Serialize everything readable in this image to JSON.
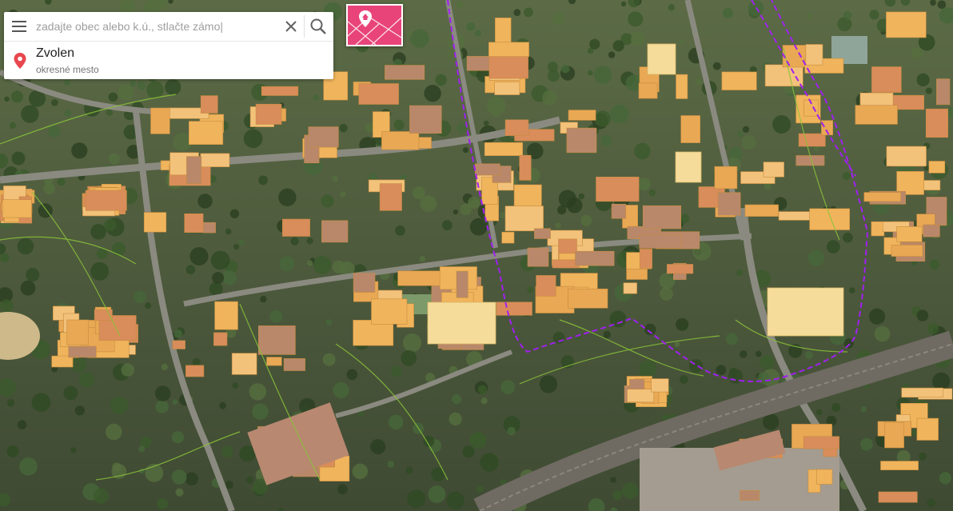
{
  "search": {
    "placeholder": "zadajte obec alebo k.ú., stlačte zámo|"
  },
  "result": {
    "title": "Zvolen",
    "subtitle": "okresné mesto"
  },
  "icons": {
    "menu": "menu-icon",
    "clear": "close-icon",
    "search": "search-icon",
    "pin": "map-pin-icon",
    "layer": "cadastre-layer-icon"
  },
  "colors": {
    "building": "#f0b45c",
    "building_dark": "#b9886a",
    "boundary": "#a020f0",
    "parcel_line": "#8ac23a",
    "layer_button": "#e8447a",
    "pin": "#e8474f"
  }
}
